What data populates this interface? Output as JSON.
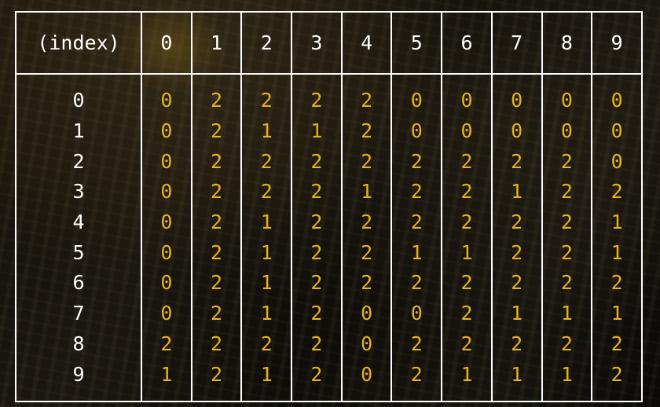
{
  "header": {
    "index_label": "(index)",
    "columns": [
      "0",
      "1",
      "2",
      "3",
      "4",
      "5",
      "6",
      "7",
      "8",
      "9"
    ]
  },
  "rows": [
    {
      "index": "0",
      "values": [
        "0",
        "2",
        "2",
        "2",
        "2",
        "0",
        "0",
        "0",
        "0",
        "0"
      ]
    },
    {
      "index": "1",
      "values": [
        "0",
        "2",
        "1",
        "1",
        "2",
        "0",
        "0",
        "0",
        "0",
        "0"
      ]
    },
    {
      "index": "2",
      "values": [
        "0",
        "2",
        "2",
        "2",
        "2",
        "2",
        "2",
        "2",
        "2",
        "0"
      ]
    },
    {
      "index": "3",
      "values": [
        "0",
        "2",
        "2",
        "2",
        "1",
        "2",
        "2",
        "1",
        "2",
        "2"
      ]
    },
    {
      "index": "4",
      "values": [
        "0",
        "2",
        "1",
        "2",
        "2",
        "2",
        "2",
        "2",
        "2",
        "1"
      ]
    },
    {
      "index": "5",
      "values": [
        "0",
        "2",
        "1",
        "2",
        "2",
        "1",
        "1",
        "2",
        "2",
        "1"
      ]
    },
    {
      "index": "6",
      "values": [
        "0",
        "2",
        "1",
        "2",
        "2",
        "2",
        "2",
        "2",
        "2",
        "2"
      ]
    },
    {
      "index": "7",
      "values": [
        "0",
        "2",
        "1",
        "2",
        "0",
        "0",
        "2",
        "1",
        "1",
        "1"
      ]
    },
    {
      "index": "8",
      "values": [
        "2",
        "2",
        "2",
        "2",
        "0",
        "2",
        "2",
        "2",
        "2",
        "2"
      ]
    },
    {
      "index": "9",
      "values": [
        "1",
        "2",
        "1",
        "2",
        "0",
        "2",
        "1",
        "1",
        "1",
        "2"
      ]
    }
  ],
  "colors": {
    "index_text": "#ffffff",
    "value_text": "#e6b21e",
    "grid_lines": "#ffffff"
  }
}
